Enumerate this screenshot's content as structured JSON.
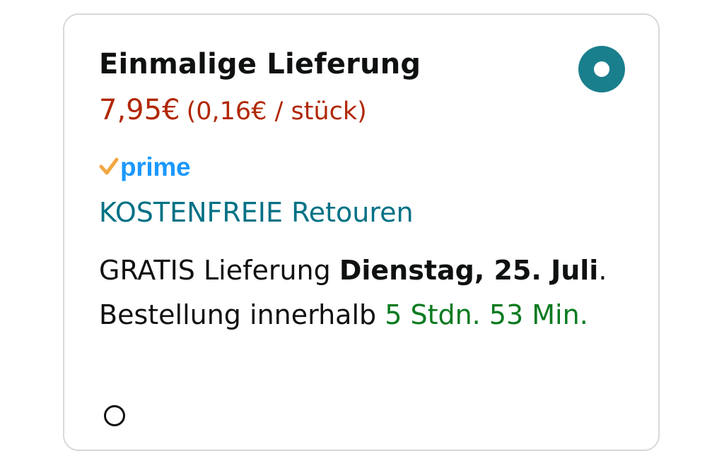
{
  "option": {
    "title": "Einmalige Lieferung",
    "price": "7,95€",
    "unit_price": "(0,16€ / stück)",
    "selected": true,
    "prime_label": "prime",
    "returns_link": "KOSTENFREIE Retouren",
    "delivery": {
      "prefix": "GRATIS Lieferung ",
      "date": "Dienstag, 25. Juli",
      "middle": ". Bestellung innerhalb ",
      "countdown": "5 Stdn. 53 Min."
    }
  },
  "colors": {
    "price": "#b12704",
    "link": "#007185",
    "radio": "#1a7f8c",
    "countdown": "#0a7a1f",
    "prime_check": "#f2a742",
    "prime_text": "#1a98ff"
  },
  "icons": {
    "radio": "radio-selected-icon",
    "prime_check": "prime-check-icon"
  }
}
